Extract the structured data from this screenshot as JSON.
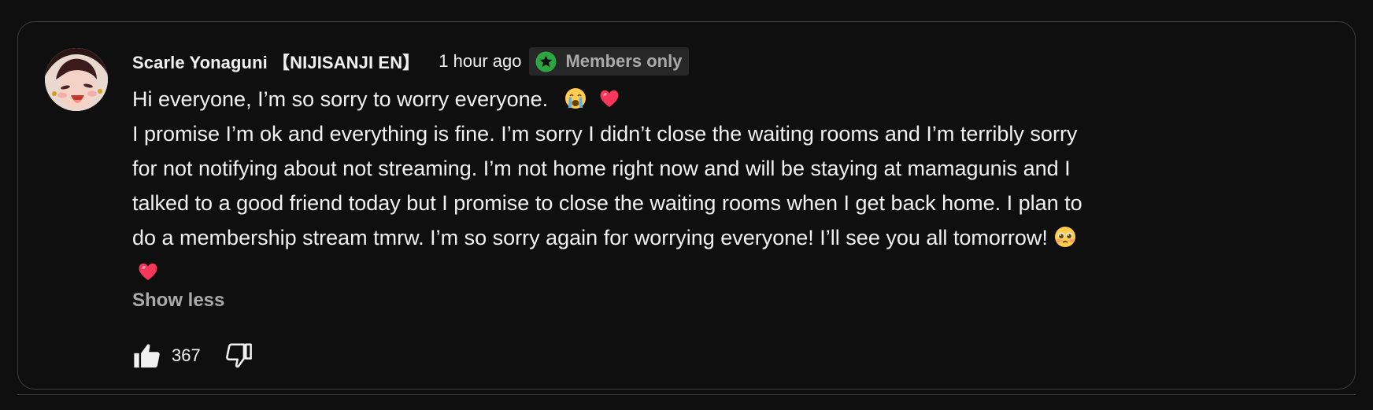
{
  "post": {
    "author": "Scarle Yonaguni 【NIJISANJI EN】",
    "time": "1 hour ago",
    "badge": {
      "label": "Members only",
      "icon": "star-badge-icon",
      "color": "#2ba640"
    },
    "body": {
      "line1": "Hi everyone, I’m so sorry to worry everyone.",
      "line2": "I promise I’m ok and everything is fine. I’m sorry I didn’t close the waiting rooms and I’m terribly sorry",
      "line3": "for not notifying about not streaming. I’m not home right now and will be staying at mamagunis and I",
      "line4": "talked to a good friend today but I promise to close the waiting rooms when I get back home. I plan to",
      "line5": "do a membership stream tmrw. I’m so sorry again for worrying everyone! I’ll see you all tomorrow!"
    },
    "show_less": "Show less",
    "likes": "367"
  },
  "icons": {
    "crying": "crying-face-emoji",
    "heart": "heart-emoji",
    "pleading": "pleading-face-emoji",
    "like": "thumbs-up-icon",
    "dislike": "thumbs-down-icon"
  },
  "colors": {
    "background": "#0f0f0f",
    "text": "#f1f1f1",
    "secondary_text": "#aaaaaa",
    "badge_bg": "#272727",
    "border": "#3f3f3f",
    "heart": "#f6365a"
  }
}
